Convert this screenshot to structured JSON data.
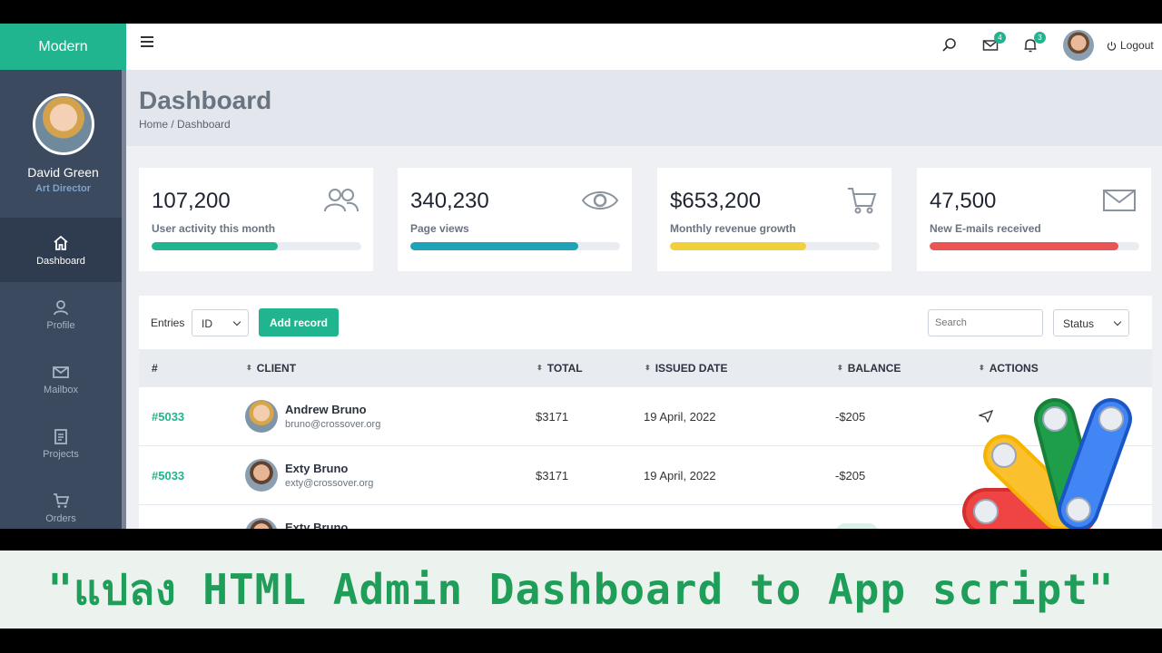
{
  "brand": "Modern",
  "user": {
    "name": "David Green",
    "role": "Art Director"
  },
  "nav": [
    {
      "label": "Dashboard",
      "icon": "home-icon",
      "active": true
    },
    {
      "label": "Profile",
      "icon": "user-icon"
    },
    {
      "label": "Mailbox",
      "icon": "mail-icon"
    },
    {
      "label": "Projects",
      "icon": "clipboard-icon"
    },
    {
      "label": "Orders",
      "icon": "cart-icon"
    }
  ],
  "topbar": {
    "mail_badge": "4",
    "notif_badge": "3",
    "logout": "Logout"
  },
  "header": {
    "title": "Dashboard",
    "breadcrumb": "Home / Dashboard"
  },
  "stats": [
    {
      "value": "107,200",
      "label": "User activity this month",
      "progress": 0.6,
      "color": "#20b58e",
      "icon": "users-icon"
    },
    {
      "value": "340,230",
      "label": "Page views",
      "progress": 0.8,
      "color": "#1fa3b8",
      "icon": "eye-icon"
    },
    {
      "value": "$653,200",
      "label": "Monthly revenue growth",
      "progress": 0.65,
      "color": "#f2d03b",
      "icon": "cart-icon"
    },
    {
      "value": "47,500",
      "label": "New E-mails received",
      "progress": 0.9,
      "color": "#ea5455",
      "icon": "envelope-icon"
    }
  ],
  "table": {
    "entries_label": "Entries",
    "entries_value": "ID",
    "add_button": "Add record",
    "search_placeholder": "Search",
    "status_value": "Status",
    "columns": [
      "#",
      "CLIENT",
      "TOTAL",
      "ISSUED DATE",
      "BALANCE",
      "ACTIONS"
    ],
    "rows": [
      {
        "id": "#5033",
        "name": "Andrew Bruno",
        "email": "bruno@crossover.org",
        "total": "$3171",
        "date": "19 April, 2022",
        "balance": "-$205"
      },
      {
        "id": "#5033",
        "name": "Exty Bruno",
        "email": "exty@crossover.org",
        "total": "$3171",
        "date": "19 April, 2022",
        "balance": "-$205"
      },
      {
        "id": "",
        "name": "Exty Bruno",
        "email": "",
        "total": "",
        "date": "",
        "balance": ""
      }
    ]
  },
  "caption": "\"แปลง HTML Admin Dashboard to App script\"",
  "colors": {
    "accent": "#20b58e",
    "sidebar": "#3c4a5f",
    "caption_text": "#1f9e5a"
  }
}
